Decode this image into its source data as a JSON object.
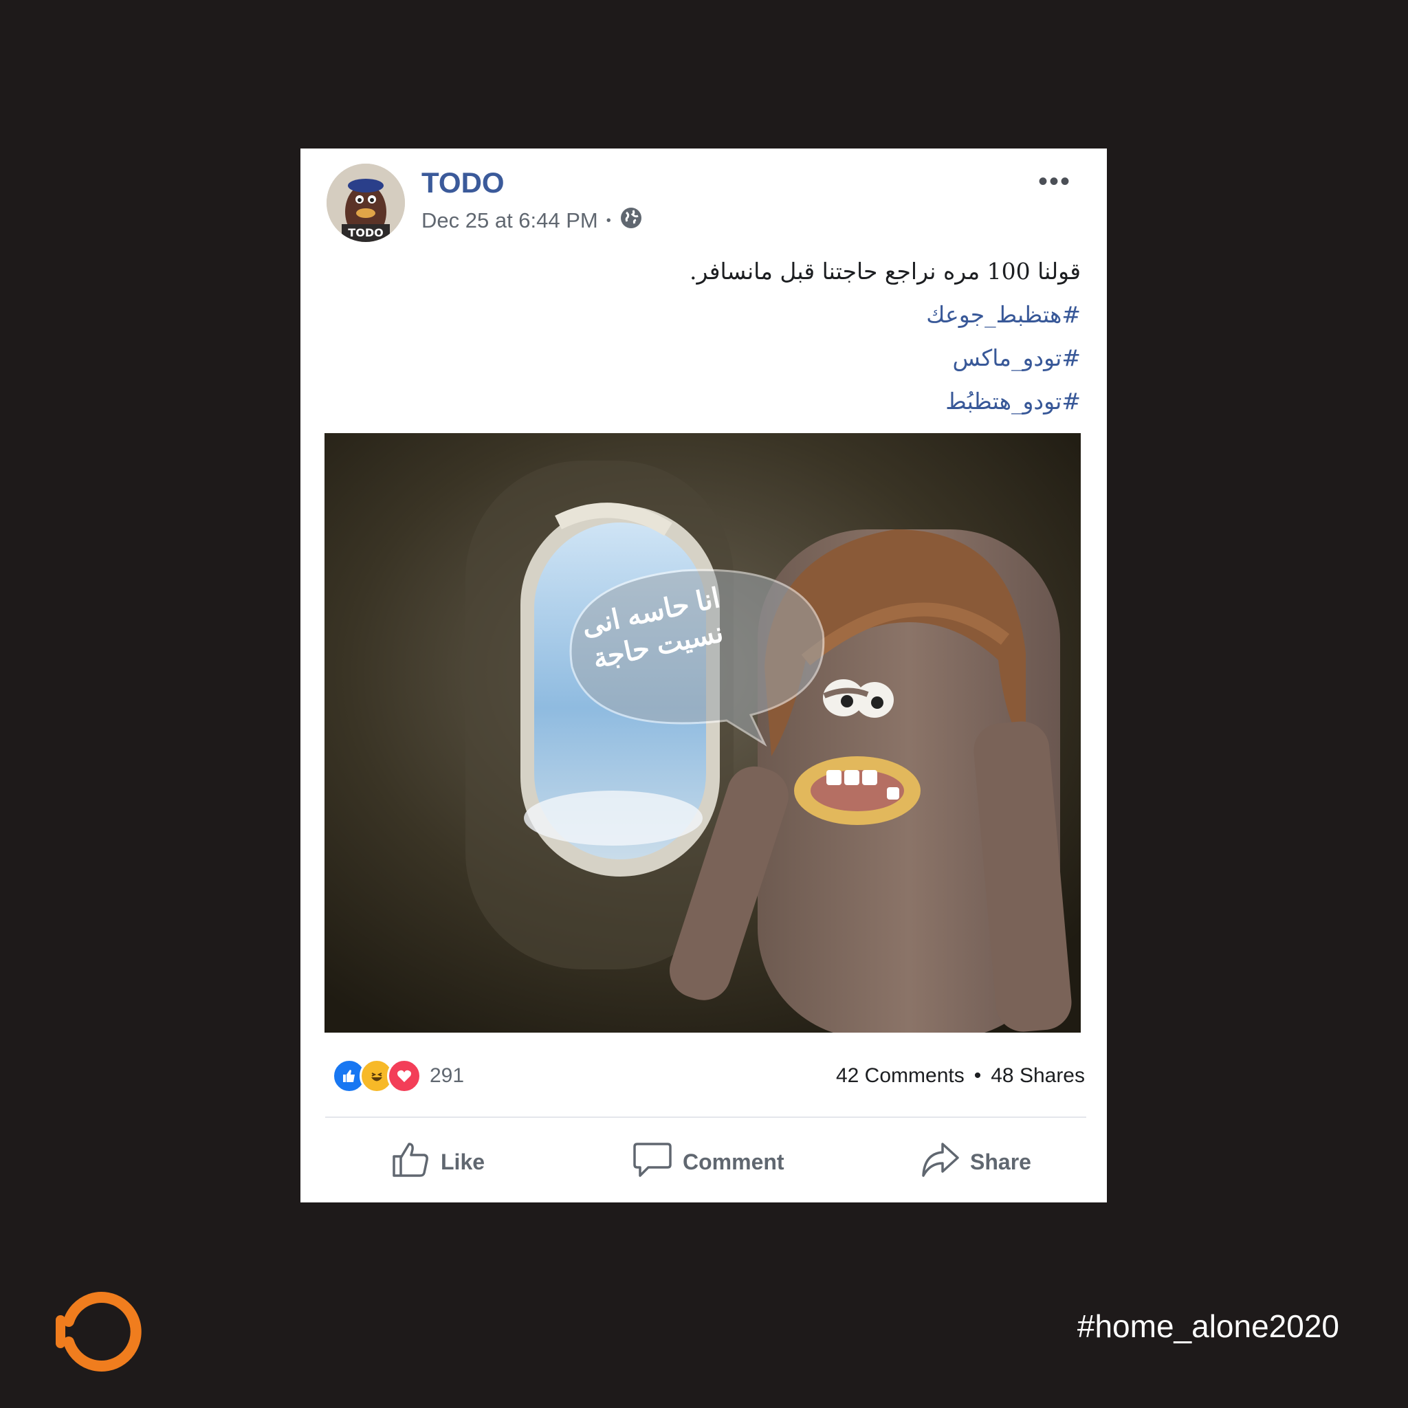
{
  "post": {
    "author": "TODO",
    "avatar_label": "TODO",
    "timestamp": "Dec 25 at 6:44 PM",
    "separator": "•",
    "more_label": "•••",
    "caption": {
      "text": "قولنا 100 مره نراجع حاجتنا قبل مانسافر.",
      "hashtags": [
        "#هتظبط_جوعك",
        "#تودو_ماكس",
        "#تودو_هتظبُط"
      ]
    },
    "image": {
      "speech_line1": "انا حاسه انى",
      "speech_line2": "نسيت حاجة"
    },
    "stats": {
      "reaction_count": "291",
      "comments": "42 Comments",
      "dot": "•",
      "shares": "48 Shares"
    },
    "actions": {
      "like": "Like",
      "comment": "Comment",
      "share": "Share"
    }
  },
  "footer": {
    "hashtag": "#home_alone2020",
    "logo_color": "#f07d1e"
  },
  "colors": {
    "background": "#1e1a1a",
    "author": "#3b5a9a",
    "hashtag_link": "#385898"
  },
  "icons": {
    "privacy": "globe-icon",
    "like": "thumbs-up-icon",
    "comment": "speech-bubble-icon",
    "share": "share-arrow-icon"
  }
}
